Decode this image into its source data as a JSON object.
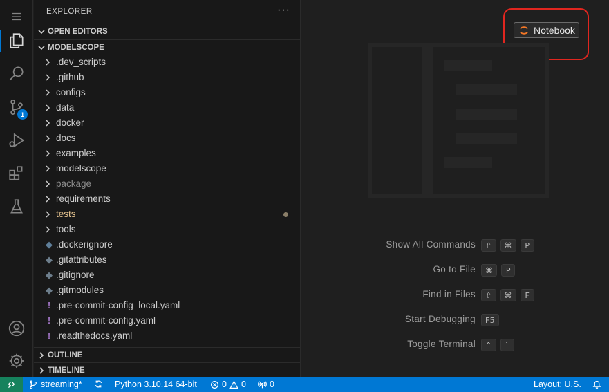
{
  "activity_bar": {
    "source_control_badge": "1",
    "items": [
      "explorer",
      "search",
      "source-control",
      "run-and-debug",
      "extensions",
      "testing",
      "accounts",
      "manage"
    ]
  },
  "sidebar": {
    "title": "EXPLORER",
    "more_actions": "···",
    "open_editors_label": "OPEN EDITORS",
    "project_label": "MODELSCOPE",
    "folders": [
      {
        "name": ".dev_scripts"
      },
      {
        "name": ".github"
      },
      {
        "name": "configs"
      },
      {
        "name": "data"
      },
      {
        "name": "docker"
      },
      {
        "name": "docs"
      },
      {
        "name": "examples"
      },
      {
        "name": "modelscope"
      },
      {
        "name": "package"
      },
      {
        "name": "requirements"
      },
      {
        "name": "tests"
      },
      {
        "name": "tools"
      }
    ],
    "files": [
      {
        "name": ".dockerignore"
      },
      {
        "name": ".gitattributes"
      },
      {
        "name": ".gitignore"
      },
      {
        "name": ".gitmodules"
      },
      {
        "name": ".pre-commit-config_local.yaml"
      },
      {
        "name": ".pre-commit-config.yaml"
      },
      {
        "name": ".readthedocs.yaml"
      }
    ],
    "outline_label": "OUTLINE",
    "timeline_label": "TIMELINE"
  },
  "editor": {
    "notebook_button": "Notebook",
    "commands": [
      {
        "label": "Show All Commands",
        "keys": [
          "⇧",
          "⌘",
          "P"
        ]
      },
      {
        "label": "Go to File",
        "keys": [
          "⌘",
          "P"
        ]
      },
      {
        "label": "Find in Files",
        "keys": [
          "⇧",
          "⌘",
          "F"
        ]
      },
      {
        "label": "Start Debugging",
        "keys": [
          "F5"
        ]
      },
      {
        "label": "Toggle Terminal",
        "keys": [
          "^",
          "`"
        ]
      }
    ]
  },
  "status_bar": {
    "branch": "streaming*",
    "python": "Python 3.10.14 64-bit",
    "errors": "0",
    "warnings": "0",
    "ports": "0",
    "layout": "Layout: U.S."
  },
  "colors": {
    "accent": "#0078d4",
    "remote": "#16825d",
    "highlight": "#e0261f",
    "modified": "#e2c08d"
  }
}
